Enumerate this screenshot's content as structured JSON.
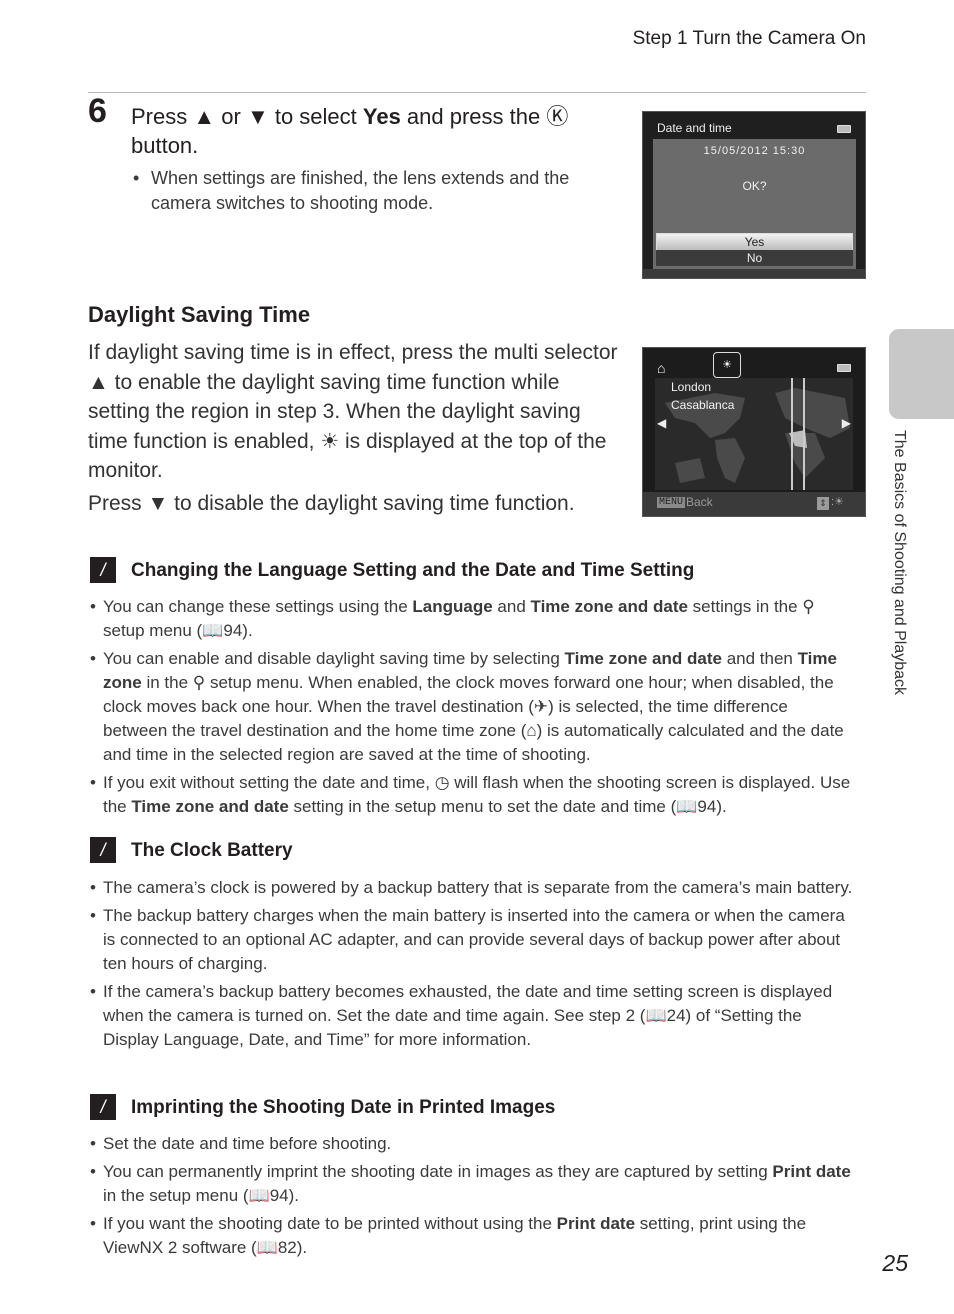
{
  "header": {
    "running_head": "Step 1 Turn the Camera On"
  },
  "step": {
    "number": "6",
    "title_parts": [
      "Press ",
      "▲",
      " or ",
      "▼",
      " to select ",
      "Yes",
      " and press the ",
      "Ⓚ",
      " button."
    ],
    "bullet": "When settings are finished, the lens extends and the camera switches to shooting mode."
  },
  "screen_date": {
    "title": "Date and time",
    "datetime": "15/05/2012 15:30",
    "prompt": "OK?",
    "options": [
      "Yes",
      "No"
    ],
    "selected": "Yes"
  },
  "screen_map": {
    "cities": [
      "London",
      "Casablanca"
    ],
    "menu_label": "MENU",
    "back_label": "Back",
    "home_icon": "home-icon",
    "dst_icon": "daylight-saving-icon"
  },
  "daylight": {
    "heading": "Daylight Saving Time",
    "p1_parts": [
      "If daylight saving time is in effect, press the multi selector ",
      "▲",
      " to enable the daylight saving time function while setting the region in step 3. When the daylight saving time function is enabled, ",
      "☀",
      " is displayed at the top of the monitor."
    ],
    "p2_parts": [
      "Press ",
      "▼",
      " to disable the daylight saving time function."
    ]
  },
  "side_tab": {
    "label": "The Basics of Shooting and Playback"
  },
  "notes": [
    {
      "heading": "Changing the Language Setting and the Date and Time Setting",
      "bullets": [
        "You can change these settings using the <b>Language</b> and <b>Time zone and date</b> settings in the ⚲ setup menu (📖94).",
        "You can enable and disable daylight saving time by selecting <b>Time zone and date</b> and then <b>Time zone</b> in the ⚲ setup menu. When enabled, the clock moves forward one hour; when disabled, the clock moves back one hour. When the travel destination (✈) is selected, the time difference between the travel destination and the home time zone (⌂) is automatically calculated and the date and time in the selected region are saved at the time of shooting.",
        "If you exit without setting the date and time, ◷ will flash when the shooting screen is displayed. Use the <b>Time zone and date</b> setting in the setup menu to set the date and time (📖94)."
      ]
    },
    {
      "heading": "The Clock Battery",
      "bullets": [
        "The camera’s clock is powered by a backup battery that is separate from the camera’s main battery.",
        "The backup battery charges when the main battery is inserted into the camera or when the camera is connected to an optional AC adapter, and can provide several days of backup power after about ten hours of charging.",
        "If the camera’s backup battery becomes exhausted, the date and time setting screen is displayed when the camera is turned on. Set the date and time again. See step 2 (📖24) of “Setting the Display Language, Date, and Time” for more information."
      ]
    },
    {
      "heading": "Imprinting the Shooting Date in Printed Images",
      "bullets": [
        "Set the date and time before shooting.",
        "You can permanently imprint the shooting date in images as they are captured by setting <b>Print date</b> in the setup menu (📖94).",
        "If you want the shooting date to be printed without using the <b>Print date</b> setting, print using the ViewNX 2 software (📖82)."
      ]
    }
  ],
  "footer": {
    "page_number": "25"
  }
}
